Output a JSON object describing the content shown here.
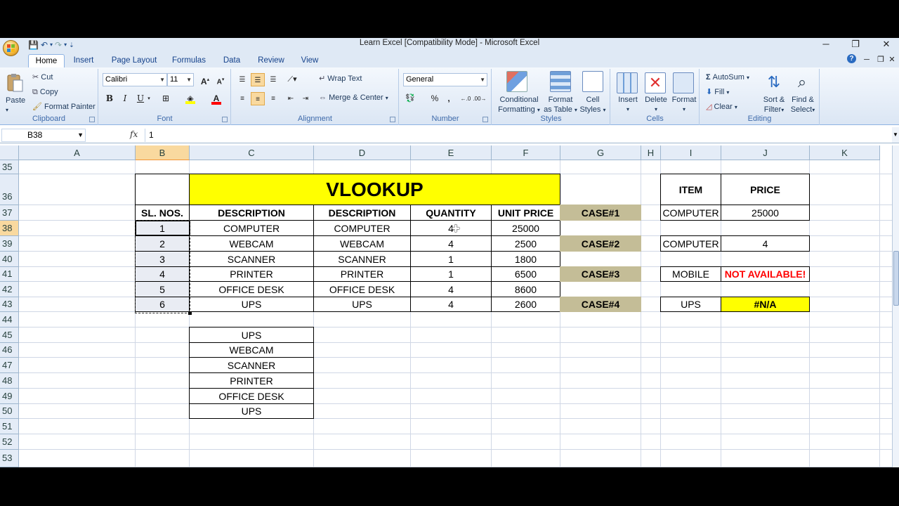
{
  "window": {
    "title": "Learn Excel  [Compatibility Mode] - Microsoft Excel",
    "minimize": "─",
    "restore": "❐",
    "close": "✕"
  },
  "ribbon_tabs": [
    "Home",
    "Insert",
    "Page Layout",
    "Formulas",
    "Data",
    "Review",
    "View"
  ],
  "ribbon": {
    "clipboard": {
      "label": "Clipboard",
      "paste": "Paste",
      "cut": "Cut",
      "copy": "Copy",
      "format_painter": "Format Painter"
    },
    "font": {
      "label": "Font",
      "font_name": "Calibri",
      "font_size": "11"
    },
    "alignment": {
      "label": "Alignment",
      "wrap_text": "Wrap Text",
      "merge_center": "Merge & Center"
    },
    "number": {
      "label": "Number",
      "format": "General",
      "percent": "%",
      "comma": ","
    },
    "styles": {
      "label": "Styles",
      "conditional_formatting": [
        "Conditional",
        "Formatting"
      ],
      "format_as_table": [
        "Format",
        "as Table"
      ],
      "cell_styles": [
        "Cell",
        "Styles"
      ]
    },
    "cells": {
      "label": "Cells",
      "insert": "Insert",
      "delete": "Delete",
      "format": "Format"
    },
    "editing": {
      "label": "Editing",
      "autosum": "AutoSum",
      "fill": "Fill",
      "clear": "Clear",
      "sort_filter": [
        "Sort &",
        "Filter"
      ],
      "find_select": [
        "Find &",
        "Select"
      ]
    }
  },
  "formula_bar": {
    "name_box": "B38",
    "fx": "fx",
    "formula": "1"
  },
  "columns": [
    "A",
    "B",
    "C",
    "D",
    "E",
    "F",
    "G",
    "H",
    "I",
    "J",
    "K"
  ],
  "selected_column": "B",
  "rows": [
    "35",
    "36",
    "37",
    "38",
    "39",
    "40",
    "41",
    "42",
    "43",
    "44",
    "45",
    "46",
    "47",
    "48",
    "49",
    "50",
    "51",
    "52",
    "53"
  ],
  "selected_row": "38",
  "sheet": {
    "main_title": "VLOOKUP",
    "headers": [
      "SL. NOS.",
      "DESCRIPTION",
      "DESCRIPTION",
      "QUANTITY",
      "UNIT PRICE"
    ],
    "table": [
      [
        "1",
        "COMPUTER",
        "COMPUTER",
        "4",
        "25000"
      ],
      [
        "2",
        "WEBCAM",
        "WEBCAM",
        "4",
        "2500"
      ],
      [
        "3",
        "SCANNER",
        "SCANNER",
        "1",
        "1800"
      ],
      [
        "4",
        "PRINTER",
        "PRINTER",
        "1",
        "6500"
      ],
      [
        "5",
        "OFFICE DESK",
        "OFFICE DESK",
        "4",
        "8600"
      ],
      [
        "6",
        "UPS",
        "UPS",
        "4",
        "2600"
      ]
    ],
    "lookup_header": {
      "item": "ITEM",
      "price": "PRICE"
    },
    "cases": [
      {
        "label": "CASE#1",
        "item": "COMPUTER",
        "result": "25000"
      },
      {
        "label": "CASE#2",
        "item": "COMPUTER",
        "result": "4"
      },
      {
        "label": "CASE#3",
        "item": "MOBILE",
        "result": "NOT AVAILABLE!"
      },
      {
        "label": "CASE#4",
        "item": "UPS",
        "result": "#N/A"
      }
    ],
    "list": [
      "UPS",
      "WEBCAM",
      "SCANNER",
      "PRINTER",
      "OFFICE DESK",
      "UPS"
    ]
  },
  "colors": {
    "title_fill": "#ffff00",
    "case_fill": "#c4bd97",
    "error_text": "#ff0000",
    "header_highlight": "#f9d99f"
  }
}
